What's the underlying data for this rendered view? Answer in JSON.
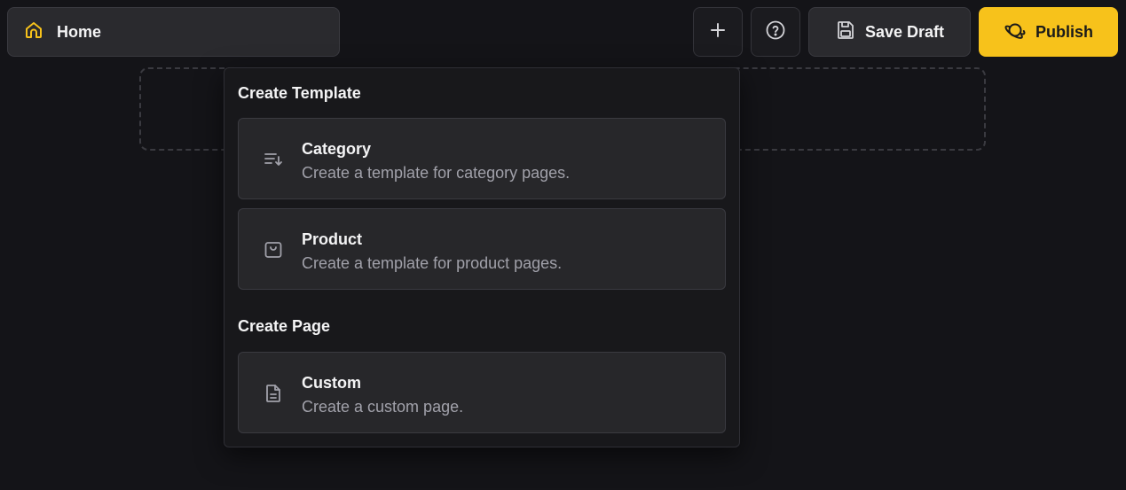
{
  "header": {
    "home": {
      "label": "Home",
      "icon": "home-icon"
    },
    "add_button": {
      "icon": "plus-icon"
    },
    "help_button": {
      "icon": "help-circle-icon"
    },
    "save_draft": {
      "label": "Save Draft",
      "icon": "save-icon"
    },
    "publish": {
      "label": "Publish",
      "icon": "planet-icon"
    }
  },
  "dropdown": {
    "template_section": {
      "title": "Create Template",
      "items": [
        {
          "title": "Category",
          "description": "Create a template for category pages.",
          "icon": "sort-list-icon"
        },
        {
          "title": "Product",
          "description": "Create a template for product pages.",
          "icon": "product-box-icon"
        }
      ]
    },
    "page_section": {
      "title": "Create Page",
      "items": [
        {
          "title": "Custom",
          "description": "Create a custom page.",
          "icon": "document-icon"
        }
      ]
    }
  },
  "colors": {
    "background": "#141418",
    "accent": "#f7c21b",
    "panel": "#27272a",
    "muted_text": "#a1a1aa"
  }
}
